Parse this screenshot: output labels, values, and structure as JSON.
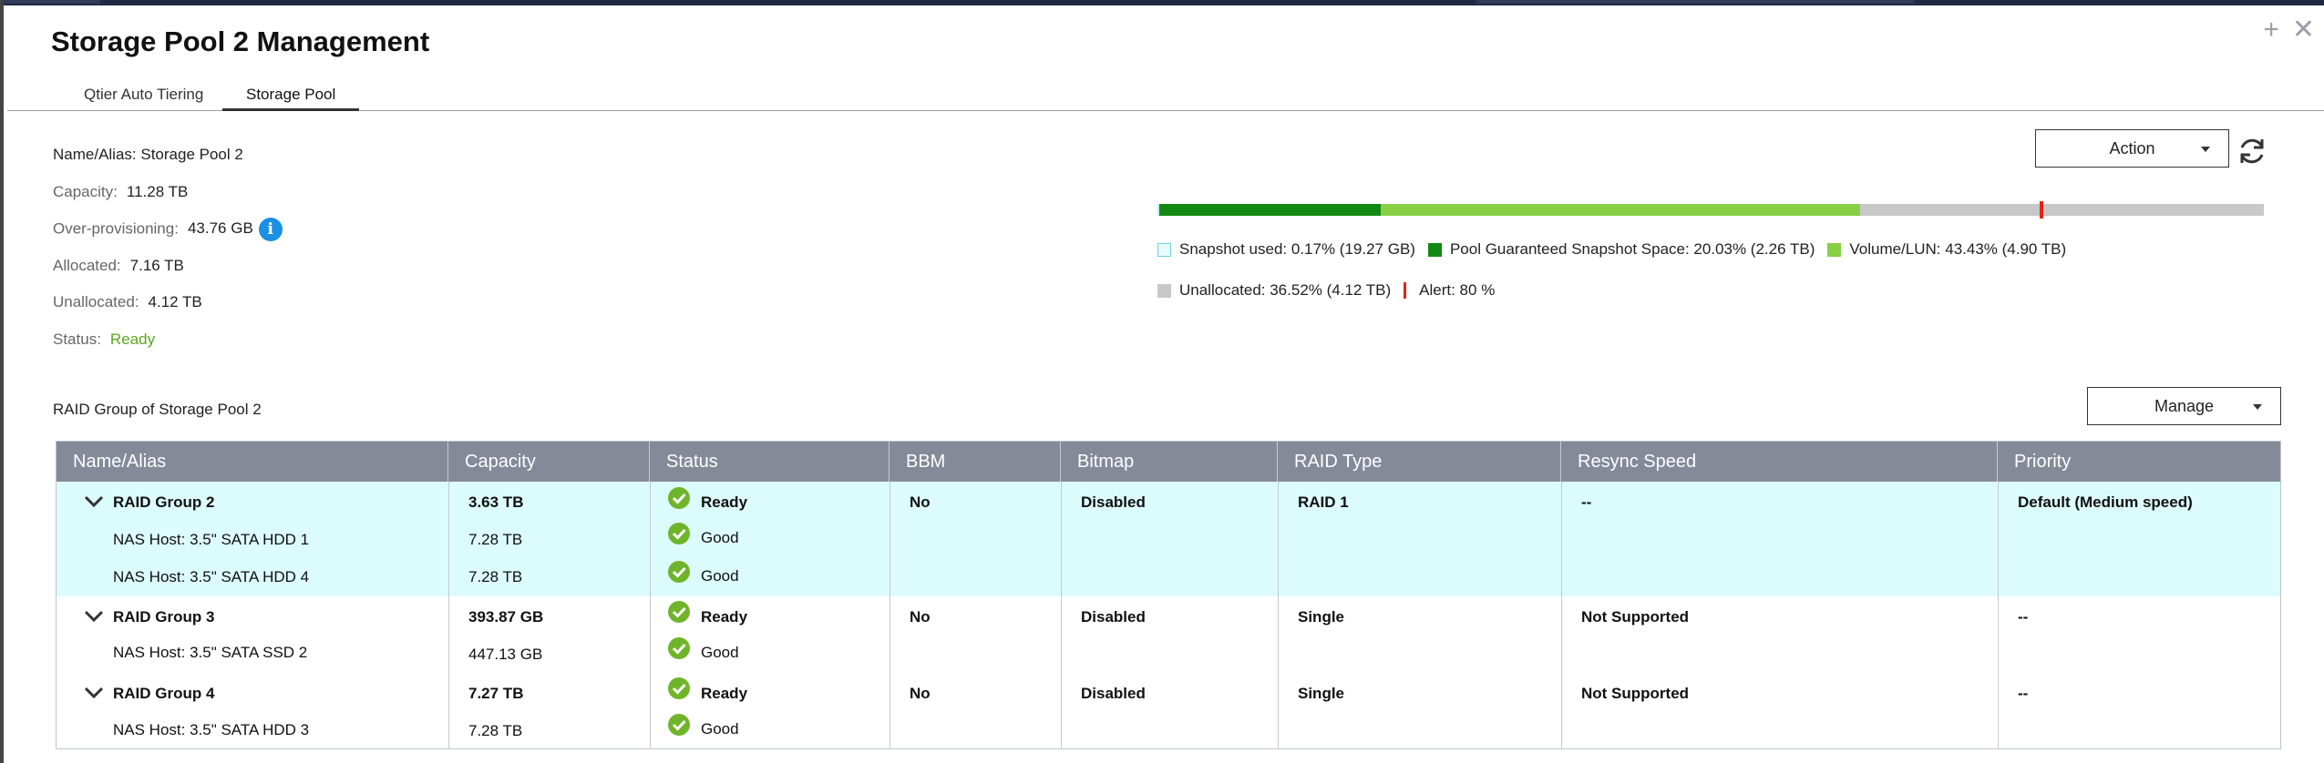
{
  "window": {
    "title": "Storage Pool 2 Management",
    "controls": {
      "add": "+",
      "close": "✕"
    }
  },
  "tabs": [
    {
      "label": "Qtier Auto Tiering",
      "active": false
    },
    {
      "label": "Storage Pool",
      "active": true
    }
  ],
  "pool": {
    "name_label": "Name/Alias: Storage Pool 2",
    "capacity": {
      "label": "Capacity:",
      "value": "11.28 TB"
    },
    "overprovisioning": {
      "label": "Over-provisioning:",
      "value": "43.76 GB",
      "icon": "info-icon"
    },
    "allocated": {
      "label": "Allocated:",
      "value": "7.16 TB"
    },
    "unallocated": {
      "label": "Unallocated:",
      "value": "4.12 TB"
    },
    "status": {
      "label": "Status:",
      "value": "Ready",
      "color": "#5aa81e"
    },
    "action_label": "Action",
    "refresh_icon": "refresh-icon"
  },
  "usage": {
    "percentages": {
      "snapshot_used": 0.17,
      "guaranteed_snapshot": 20.03,
      "volume_lun": 43.43,
      "unallocated": 36.52,
      "alert": 80
    },
    "colors": {
      "snapshot_used": "#bdf0f3",
      "guaranteed_snapshot": "#128a12",
      "volume_lun": "#88cf45",
      "unallocated": "#c8c8c8",
      "alert": "#e2231a"
    },
    "legend": {
      "snapshot_used": "Snapshot used: 0.17% (19.27 GB)",
      "guaranteed_snapshot": "Pool Guaranteed Snapshot Space: 20.03% (2.26 TB)",
      "volume_lun": "Volume/LUN: 43.43% (4.90 TB)",
      "unallocated": "Unallocated: 36.52% (4.12 TB)",
      "alert": "Alert: 80 %"
    }
  },
  "raid": {
    "title": "RAID Group of Storage Pool 2",
    "manage_label": "Manage",
    "columns": [
      "Name/Alias",
      "Capacity",
      "Status",
      "BBM",
      "Bitmap",
      "RAID Type",
      "Resync Speed",
      "Priority"
    ],
    "groups": [
      {
        "name": "RAID Group 2",
        "capacity": "3.63 TB",
        "status": "Ready",
        "bbm": "No",
        "bitmap": "Disabled",
        "raid_type": "RAID 1",
        "resync": "--",
        "priority": "Default (Medium speed)",
        "selected": true,
        "disks": [
          {
            "name": "NAS Host: 3.5\" SATA HDD 1",
            "capacity": "7.28 TB",
            "status": "Good"
          },
          {
            "name": "NAS Host: 3.5\" SATA HDD 4",
            "capacity": "7.28 TB",
            "status": "Good"
          }
        ]
      },
      {
        "name": "RAID Group 3",
        "capacity": "393.87 GB",
        "status": "Ready",
        "bbm": "No",
        "bitmap": "Disabled",
        "raid_type": "Single",
        "resync": "Not Supported",
        "priority": "--",
        "selected": false,
        "disks": [
          {
            "name": "NAS Host: 3.5\" SATA SSD 2",
            "capacity": "447.13 GB",
            "status": "Good"
          }
        ]
      },
      {
        "name": "RAID Group 4",
        "capacity": "7.27 TB",
        "status": "Ready",
        "bbm": "No",
        "bitmap": "Disabled",
        "raid_type": "Single",
        "resync": "Not Supported",
        "priority": "--",
        "selected": false,
        "disks": [
          {
            "name": "NAS Host: 3.5\" SATA HDD 3",
            "capacity": "7.28 TB",
            "status": "Good"
          }
        ]
      }
    ],
    "colors": {
      "header_bg": "#858a99",
      "selected_bg": "#dcfbfc",
      "ok_green": "#6fb52b"
    }
  }
}
